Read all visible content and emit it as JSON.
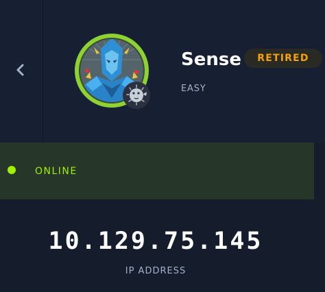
{
  "machine": {
    "name": "Sense",
    "status": "RETIRED",
    "difficulty": "EASY",
    "avatar_icon": "knight-mask-avatar-icon",
    "os_icon": "pufferfish-freebsd-icon"
  },
  "connection": {
    "state": "ONLINE",
    "ip": "10.129.75.145",
    "ip_label": "IP ADDRESS"
  },
  "colors": {
    "background": "#151d2d",
    "header": "#162032",
    "accent_green": "#9fef00",
    "retired_orange": "#f4a10c",
    "muted_text": "#a4b1cd"
  }
}
